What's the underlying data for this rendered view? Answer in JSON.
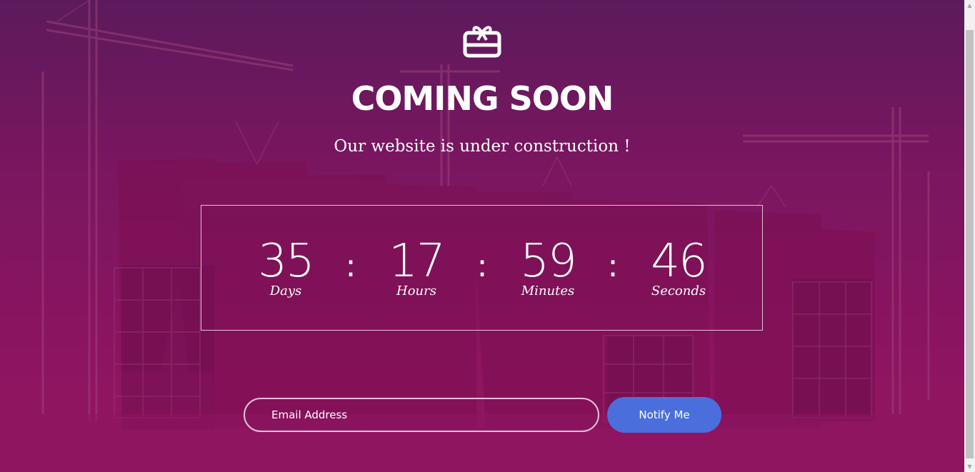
{
  "page": {
    "icon": "gift-card-icon",
    "title": "COMING SOON",
    "subtitle": "Our website is under construction !"
  },
  "countdown": {
    "days": {
      "value": "35",
      "label": "Days"
    },
    "hours": {
      "value": "17",
      "label": "Hours"
    },
    "minutes": {
      "value": "59",
      "label": "Minutes"
    },
    "seconds": {
      "value": "46",
      "label": "Seconds"
    },
    "separator": ":"
  },
  "form": {
    "email_placeholder": "Email Address",
    "notify_label": "Notify Me"
  },
  "colors": {
    "background": "#7a1660",
    "button": "#4a6fdc",
    "text": "#ffffff"
  }
}
